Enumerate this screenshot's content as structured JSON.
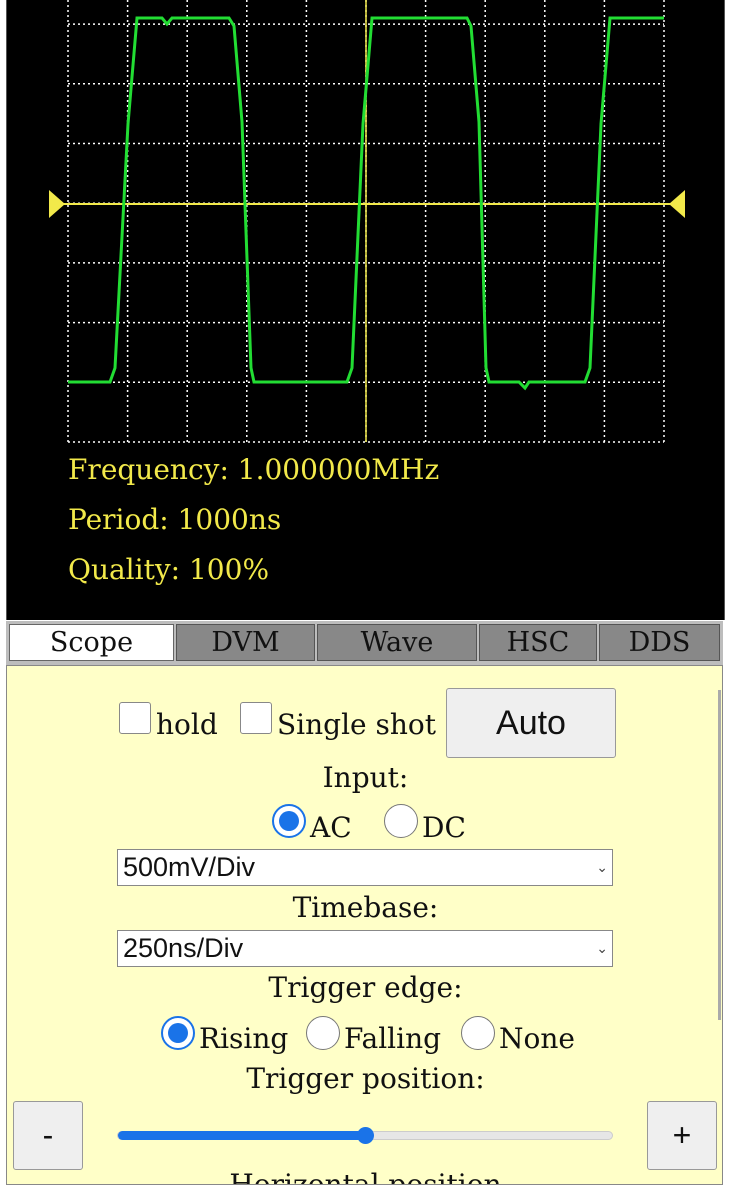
{
  "scope": {
    "frequency": "Frequency: 1.000000MHz",
    "period": "Period: 1000ns",
    "quality": "Quality: 100%",
    "colors": {
      "background": "#000000",
      "grid": "#ffffff",
      "trace": "#22dd33",
      "trigger": "#f2e94a"
    }
  },
  "tabs": [
    {
      "label": "Scope",
      "active": true
    },
    {
      "label": "DVM",
      "active": false
    },
    {
      "label": "Wave",
      "active": false
    },
    {
      "label": "HSC",
      "active": false
    },
    {
      "label": "DDS",
      "active": false
    }
  ],
  "controls": {
    "hold_label": "hold",
    "single_shot_label": "Single shot",
    "auto_label": "Auto",
    "input_label": "Input:",
    "ac_label": "AC",
    "dc_label": "DC",
    "coupling_selected": "AC",
    "volts_div": "500mV/Div",
    "timebase_label": "Timebase:",
    "timebase": "250ns/Div",
    "trigger_edge_label": "Trigger edge:",
    "rising_label": "Rising",
    "falling_label": "Falling",
    "none_label": "None",
    "trigger_edge_selected": "Rising",
    "trigger_position_label": "Trigger position:",
    "minus_label": "-",
    "plus_label": "+",
    "trigger_position_fraction": 0.5,
    "horizontal_position_label": "Horizontal position"
  }
}
